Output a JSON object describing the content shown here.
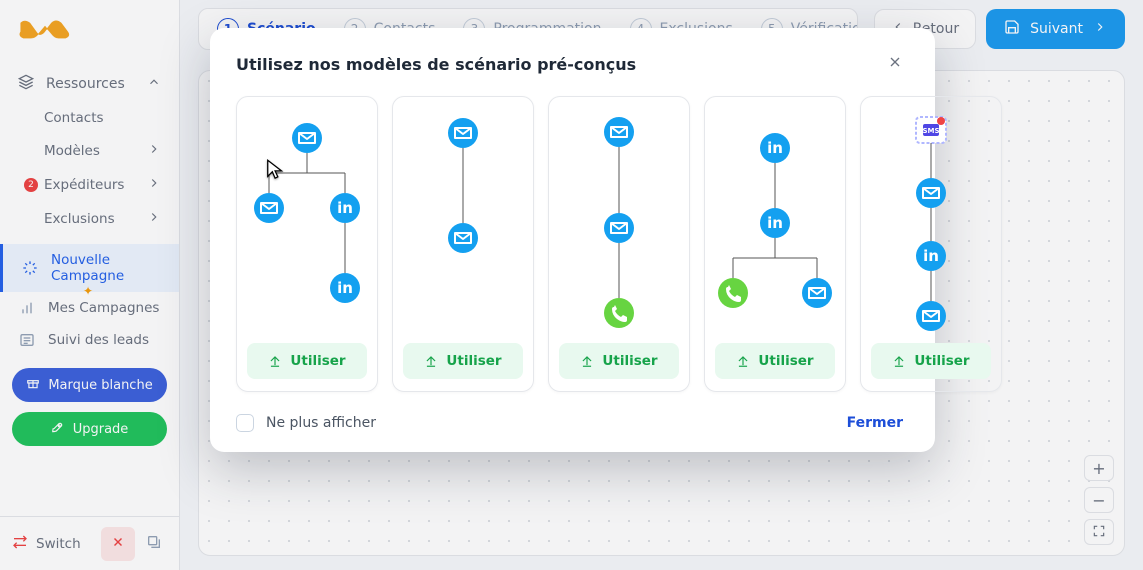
{
  "sidebar": {
    "section_label": "Ressources",
    "items": {
      "contacts": "Contacts",
      "models": "Modèles",
      "senders": "Expéditeurs",
      "senders_badge": "2",
      "exclusions": "Exclusions"
    },
    "new_campaign": "Nouvelle Campagne",
    "my_campaigns": "Mes Campagnes",
    "lead_tracking": "Suivi des leads",
    "white_label_btn": "Marque blanche",
    "upgrade_btn": "Upgrade",
    "switch": "Switch"
  },
  "stepper": {
    "steps": [
      {
        "num": "1",
        "label": "Scénario"
      },
      {
        "num": "2",
        "label": "Contacts"
      },
      {
        "num": "3",
        "label": "Programmation"
      },
      {
        "num": "4",
        "label": "Exclusions"
      },
      {
        "num": "5",
        "label": "Vérification"
      }
    ],
    "back": "Retour",
    "next": "Suivant"
  },
  "modal": {
    "title": "Utilisez nos modèles de scénario pré-conçus",
    "use_label": "Utiliser",
    "dont_show": "Ne plus afficher",
    "close": "Fermer"
  }
}
